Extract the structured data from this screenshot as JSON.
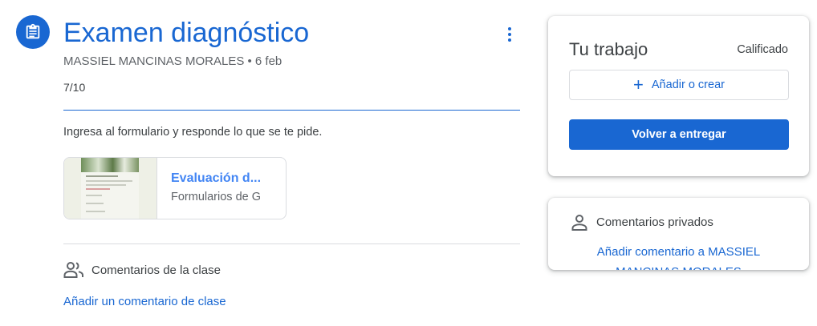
{
  "assignment": {
    "icon": "assignment-icon",
    "title": "Examen diagnóstico",
    "meta": "MASSIEL MANCINAS MORALES • 6 feb",
    "grade": "7/10",
    "instructions": "Ingresa al formulario y responde lo que se te pide.",
    "more_icon": "more-vert-icon"
  },
  "attachment": {
    "title": "Evaluación d...",
    "subtitle": "Formularios de G"
  },
  "class_comments": {
    "icon": "people-icon",
    "label": "Comentarios de la clase",
    "add_link": "Añadir un comentario de clase"
  },
  "your_work": {
    "title": "Tu trabajo",
    "status": "Calificado",
    "add_button": "Añadir o crear",
    "resubmit_button": "Volver a entregar"
  },
  "private_comments": {
    "icon": "person-icon",
    "label": "Comentarios privados",
    "add_link": "Añadir comentario a MASSIEL MANCINAS MORALES"
  },
  "colors": {
    "accent": "#1967d2",
    "link": "#4285f4",
    "text": "#3c4043",
    "secondary_text": "#5f6368"
  }
}
